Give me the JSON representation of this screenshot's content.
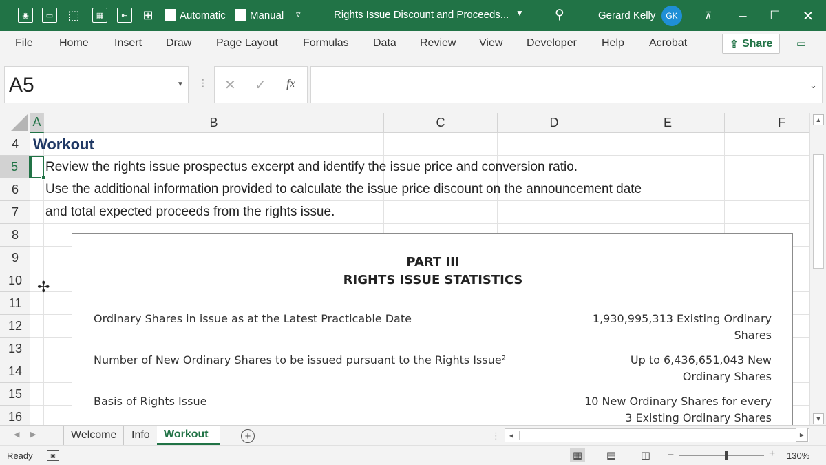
{
  "titlebar": {
    "autosave_automatic": "Automatic",
    "autosave_manual": "Manual",
    "document_title": "Rights Issue Discount and Proceeds...",
    "user_name": "Gerard Kelly",
    "user_initials": "GK"
  },
  "menu": {
    "items": [
      "File",
      "Home",
      "Insert",
      "Draw",
      "Page Layout",
      "Formulas",
      "Data",
      "Review",
      "View",
      "Developer",
      "Help",
      "Acrobat"
    ],
    "share_label": "Share"
  },
  "formula_bar": {
    "name_box": "A5",
    "formula_value": "",
    "fx_label": "fx"
  },
  "grid": {
    "columns": [
      "A",
      "B",
      "C",
      "D",
      "E",
      "F"
    ],
    "selected_column": "A",
    "rows": [
      "4",
      "5",
      "6",
      "7",
      "8",
      "9",
      "10",
      "11",
      "12",
      "13",
      "14",
      "15",
      "16"
    ],
    "selected_row": "5",
    "cells": {
      "A4": "Workout",
      "B5": "Review the rights issue prospectus excerpt and identify the issue price and conversion ratio.",
      "B6": "Use the additional information provided to calculate the issue price discount on the announcement date",
      "B7": "and total expected proceeds from the rights issue."
    }
  },
  "embedded_image": {
    "part": "PART III",
    "title": "RIGHTS ISSUE STATISTICS",
    "rows": [
      {
        "label": "Ordinary Shares in issue as at the Latest Practicable Date",
        "value_line1": "1,930,995,313 Existing Ordinary",
        "value_line2": "Shares"
      },
      {
        "label": "Number of New Ordinary Shares to be issued pursuant to the Rights Issue²",
        "value_line1": "Up to 6,436,651,043 New",
        "value_line2": "Ordinary Shares"
      },
      {
        "label": "Basis of Rights Issue",
        "value_line1": "10 New Ordinary Shares for every",
        "value_line2": "3 Existing Ordinary Shares"
      }
    ]
  },
  "sheets": {
    "tabs": [
      "Welcome",
      "Info",
      "Workout"
    ],
    "active": "Workout"
  },
  "status": {
    "ready": "Ready",
    "zoom": "130%"
  },
  "colors": {
    "accent": "#217346",
    "title_text": "#1f3864"
  }
}
